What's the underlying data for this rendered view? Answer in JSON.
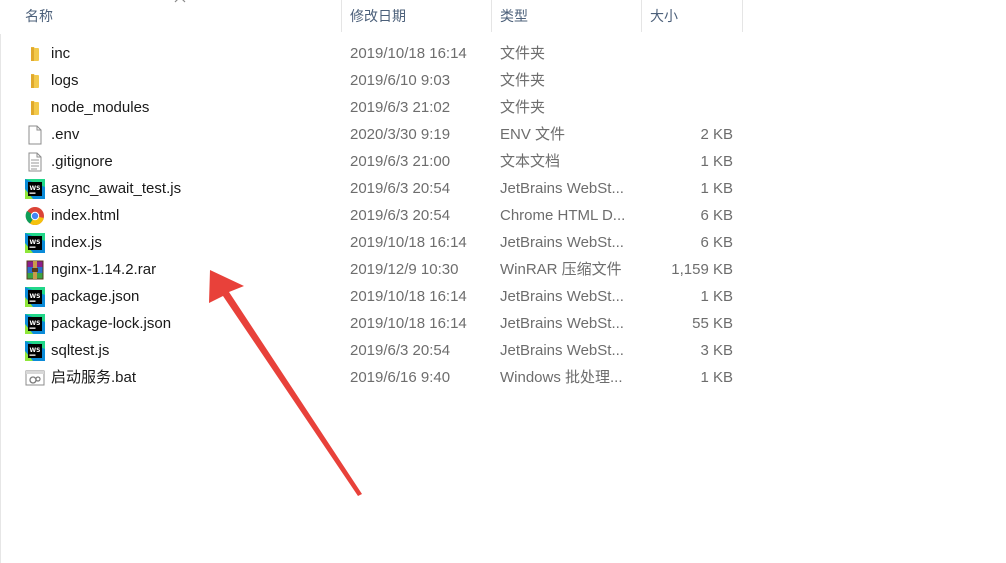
{
  "columns": {
    "name": "名称",
    "modified": "修改日期",
    "type": "类型",
    "size": "大小"
  },
  "files": [
    {
      "name": "inc",
      "modified": "2019/10/18 16:14",
      "type": "文件夹",
      "size": "",
      "icon": "folder-icon"
    },
    {
      "name": "logs",
      "modified": "2019/6/10 9:03",
      "type": "文件夹",
      "size": "",
      "icon": "folder-icon"
    },
    {
      "name": "node_modules",
      "modified": "2019/6/3 21:02",
      "type": "文件夹",
      "size": "",
      "icon": "folder-icon"
    },
    {
      "name": ".env",
      "modified": "2020/3/30 9:19",
      "type": "ENV 文件",
      "size": "2 KB",
      "icon": "blank-file-icon"
    },
    {
      "name": ".gitignore",
      "modified": "2019/6/3 21:00",
      "type": "文本文档",
      "size": "1 KB",
      "icon": "text-file-icon"
    },
    {
      "name": "async_await_test.js",
      "modified": "2019/6/3 20:54",
      "type": "JetBrains WebSt...",
      "size": "1 KB",
      "icon": "webstorm-icon"
    },
    {
      "name": "index.html",
      "modified": "2019/6/3 20:54",
      "type": "Chrome HTML D...",
      "size": "6 KB",
      "icon": "chrome-icon"
    },
    {
      "name": "index.js",
      "modified": "2019/10/18 16:14",
      "type": "JetBrains WebSt...",
      "size": "6 KB",
      "icon": "webstorm-icon"
    },
    {
      "name": "nginx-1.14.2.rar",
      "modified": "2019/12/9 10:30",
      "type": "WinRAR 压缩文件",
      "size": "1,159 KB",
      "icon": "winrar-icon"
    },
    {
      "name": "package.json",
      "modified": "2019/10/18 16:14",
      "type": "JetBrains WebSt...",
      "size": "1 KB",
      "icon": "webstorm-icon"
    },
    {
      "name": "package-lock.json",
      "modified": "2019/10/18 16:14",
      "type": "JetBrains WebSt...",
      "size": "55 KB",
      "icon": "webstorm-icon"
    },
    {
      "name": "sqltest.js",
      "modified": "2019/6/3 20:54",
      "type": "JetBrains WebSt...",
      "size": "3 KB",
      "icon": "webstorm-icon"
    },
    {
      "name": "启动服务.bat",
      "modified": "2019/6/16 9:40",
      "type": "Windows 批处理...",
      "size": "1 KB",
      "icon": "batch-file-icon"
    }
  ],
  "annotation": {
    "color": "#e8413a",
    "icon": "red-arrow-annotation"
  }
}
